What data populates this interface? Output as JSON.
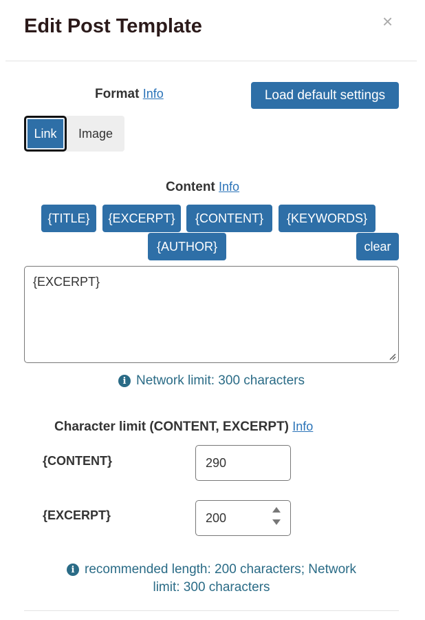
{
  "modal": {
    "title": "Edit Post Template",
    "close_icon": "×"
  },
  "format": {
    "label": "Format",
    "info": "Info",
    "load_defaults": "Load default settings",
    "options": [
      "Link",
      "Image"
    ],
    "selected": "Link"
  },
  "content": {
    "label": "Content",
    "info": "Info",
    "tags": [
      "{TITLE}",
      "{EXCERPT}",
      "{CONTENT}",
      "{KEYWORDS}",
      "{AUTHOR}"
    ],
    "clear": "clear",
    "value": "{EXCERPT}",
    "network_limit": "Network limit: 300 characters"
  },
  "char_limit": {
    "label": "Character limit (CONTENT, EXCERPT)",
    "info": "Info",
    "content_label": "{CONTENT}",
    "content_value": "290",
    "excerpt_label": "{EXCERPT}",
    "excerpt_value": "200",
    "note_line1": "recommended length: 200 characters; Network",
    "note_line2": "limit: 300 characters"
  },
  "colors": {
    "primary": "#2e6fa7",
    "info_text": "#2a6b86",
    "link": "#2a73b8"
  },
  "icons": {
    "info": "info-circle-icon",
    "close": "close-icon"
  }
}
